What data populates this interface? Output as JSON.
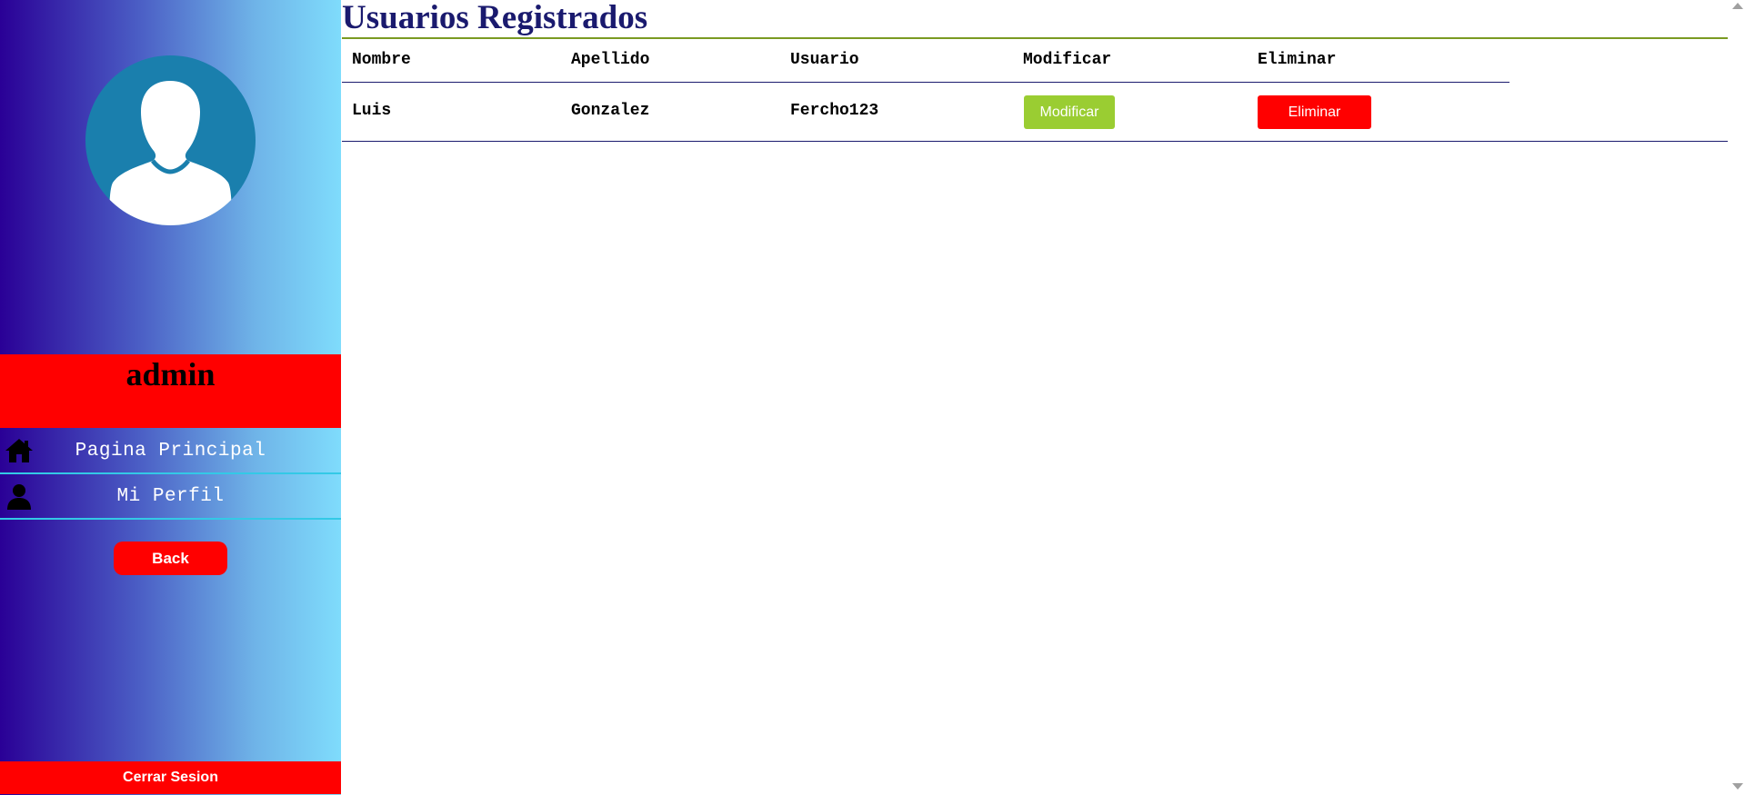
{
  "sidebar": {
    "user_name": "admin",
    "nav_items": [
      {
        "label": "Pagina Principal",
        "icon": "home-icon"
      },
      {
        "label": "Mi Perfil",
        "icon": "user-icon"
      }
    ],
    "back_label": "Back",
    "logout_label": "Cerrar Sesion",
    "avatar_icon": "user-avatar-icon"
  },
  "main": {
    "title": "Usuarios Registrados",
    "table": {
      "headers": [
        "Nombre",
        "Apellido",
        "Usuario",
        "Modificar",
        "Eliminar"
      ],
      "rows": [
        {
          "nombre": "Luis",
          "apellido": "Gonzalez",
          "usuario": "Fercho123",
          "modificar_label": "Modificar",
          "eliminar_label": "Eliminar"
        }
      ]
    }
  },
  "colors": {
    "accent_red": "#ff0000",
    "modify_green": "#9acd32",
    "title_navy": "#1a1a6e",
    "sidebar_gradient_start": "#2a0096",
    "sidebar_gradient_end": "#7fdcfc"
  }
}
